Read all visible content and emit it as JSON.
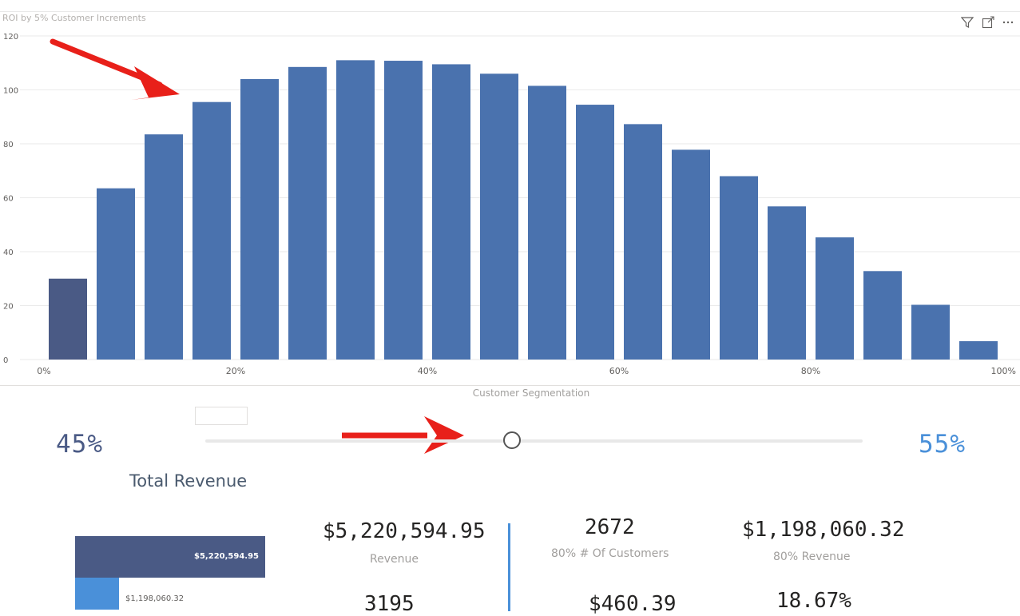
{
  "visual": {
    "title": "ROI by 5% Customer Increments"
  },
  "header_icons": [
    "filter-icon",
    "focus-mode-icon",
    "more-options-icon"
  ],
  "colors": {
    "bar": "#4a72ae",
    "bar_highlight": "#4a5a85",
    "accent_light": "#4a90d9",
    "arrow": "#e8201a"
  },
  "chart_data": {
    "type": "bar",
    "title": "ROI by 5% Customer Increments",
    "xlabel": "Customer Segmentation",
    "ylabel": "",
    "x": [
      5,
      10,
      15,
      20,
      25,
      30,
      35,
      40,
      45,
      50,
      55,
      60,
      65,
      70,
      75,
      80,
      85,
      90,
      95,
      100
    ],
    "values": [
      30,
      63.5,
      83.5,
      95.5,
      104,
      108.5,
      111,
      110.8,
      109.5,
      106,
      101.5,
      94.5,
      87.3,
      77.8,
      68,
      56.8,
      45.3,
      32.8,
      20.3,
      6.8
    ],
    "highlight_index": 0,
    "xlim": [
      0,
      100
    ],
    "ylim": [
      0,
      120
    ],
    "yticks": [
      0,
      20,
      40,
      60,
      80,
      100,
      120
    ],
    "xticks": [
      0,
      20,
      40,
      60,
      80,
      100
    ],
    "xtick_labels": [
      "0%",
      "20%",
      "40%",
      "60%",
      "80%",
      "100%"
    ],
    "grid": true
  },
  "slider": {
    "title": "Customer Segmentation",
    "left_value": "45%",
    "right_value": "55%",
    "position": 0.47
  },
  "total_revenue": {
    "title": "Total Revenue",
    "bar_total_label": "$5,220,594.95",
    "bar_part_label": "$1,198,060.32",
    "part_fraction": 0.2295
  },
  "kpis": [
    {
      "value": "$5,220,594.95",
      "label": "Revenue"
    },
    {
      "value": "2672",
      "label": "80% # Of Customers"
    },
    {
      "value": "$1,198,060.32",
      "label": "80% Revenue"
    },
    {
      "value": "3195",
      "label": ""
    },
    {
      "value": "$460.39",
      "label": ""
    },
    {
      "value": "18.67%",
      "label": ""
    }
  ]
}
